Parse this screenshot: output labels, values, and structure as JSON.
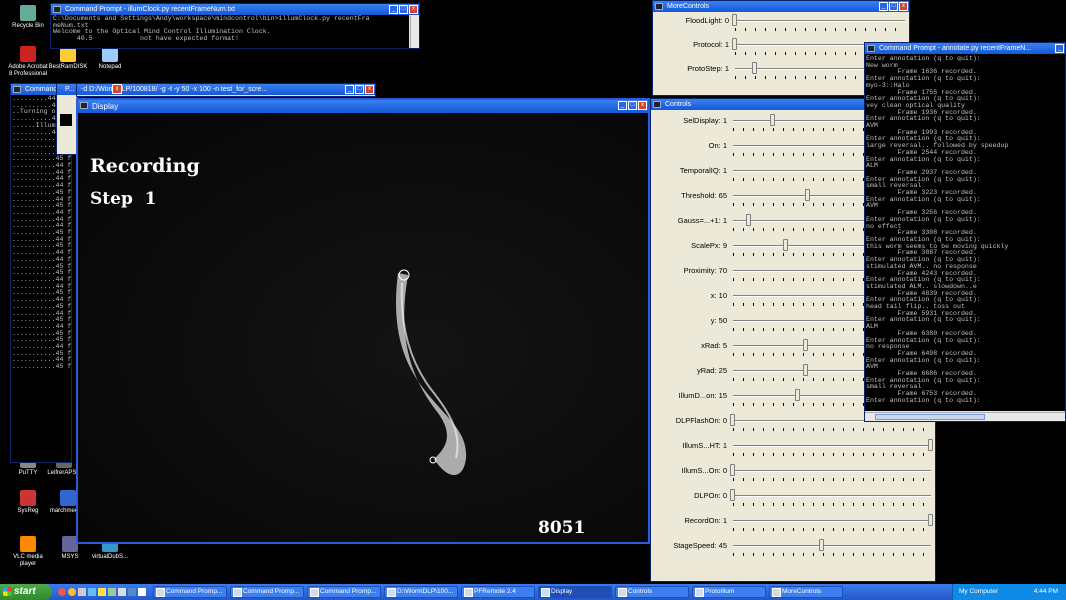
{
  "desktop": {
    "icons": [
      {
        "name": "recycle-bin-icon",
        "label": "Recycle Bin",
        "color": "#6a9"
      },
      {
        "name": "acrobat-icon",
        "label": "Adobe Acrobat 8 Professional",
        "color": "#c22"
      },
      {
        "name": "bestramdisk-icon",
        "label": "BestRamDISK",
        "color": "#fc3"
      },
      {
        "name": "notepad-icon",
        "label": "Notepad",
        "color": "#9cf"
      },
      {
        "name": "putty-icon",
        "label": "PuTTY",
        "color": "#888"
      },
      {
        "name": "lehrer-icon",
        "label": "LeifrerAPSR",
        "color": "#666"
      },
      {
        "name": "sysreg-icon",
        "label": "SysReg",
        "color": "#c33"
      },
      {
        "name": "marchmeeting-icon",
        "label": "marchmeeti...",
        "color": "#36c"
      },
      {
        "name": "vlc-icon",
        "label": "VLC media player",
        "color": "#f80"
      },
      {
        "name": "msys-icon",
        "label": "MSYS",
        "color": "#669"
      },
      {
        "name": "virtualdub-icon",
        "label": "virtualDubS...",
        "color": "#39c"
      }
    ]
  },
  "illum_window": {
    "title": "Command Prompt - illumClock.py recentFrameNum.txt",
    "lines": [
      "C:\\Documents and Settings\\Andy\\workspace\\mindcontrol\\bin>illumClock.py recentFra",
      "meNum.txt",
      "Welcome to the Optical Mind Control Illumination Clock.",
      "      40.5            not have expected format!"
    ]
  },
  "back_cmd": {
    "title": "Command",
    "lines": [
      ".........44 fps",
      "..........44 fps",
      "..Turning on DLP",
      "..........44 fps",
      "......Illuminat",
      "..........44 fps",
      "...........44 fp",
      "...........44 fp",
      "...........44 fp",
      "...........45 fp",
      "...........44 fp",
      "...........44 fp",
      "...........44 fp",
      "...........44 fp",
      "...........45 fp",
      "...........44 fp",
      "...........45 fp",
      "...........44 fp",
      "...........44 fp",
      "...........44 fp",
      "...........45 fp",
      "...........44 fp",
      "...........45 fp",
      "...........44 fp",
      "...........44 fp",
      "...........45 fp",
      "...........45 fp",
      "...........44 fp",
      "...........44 fp",
      "...........45 fp",
      "...........44 fp",
      "...........45 fp",
      "...........44 fp",
      "...........45 fp",
      "...........44 fp",
      "...........45 fp",
      "...........45 fp",
      "...........44 fp",
      "...........45 fp",
      "...........44 fp",
      "...........45 fp"
    ],
    "small_title": "P...",
    "dlp_title": "-d D:/WormDLP/100818/ -g -t -y 50 -x 100 -n test_for_scre..."
  },
  "display_window": {
    "title": "Display",
    "status_line1": "Recording",
    "status_line2": "Step  1",
    "frame_number": "8051"
  },
  "more_controls": {
    "title": "MoreControls",
    "sliders": [
      {
        "label": "FloodLight: 0",
        "value": 0
      },
      {
        "label": "Protocol: 1",
        "value": 0.0
      },
      {
        "label": "ProtoStep: 1",
        "value": 0.12
      }
    ]
  },
  "controls": {
    "title": "Controls",
    "sliders": [
      {
        "label": "SelDisplay: 1",
        "value": 0.2
      },
      {
        "label": "On: 1",
        "value": 1.0
      },
      {
        "label": "TemporalIQ: 1",
        "value": 1.0
      },
      {
        "label": "Threshold: 65",
        "value": 0.38
      },
      {
        "label": "Gauss=...+1: 1",
        "value": 0.08
      },
      {
        "label": "ScalePx: 9",
        "value": 0.27
      },
      {
        "label": "Proximity: 70",
        "value": 1.0
      },
      {
        "label": "x: 10",
        "value": 0.74
      },
      {
        "label": "y: 50",
        "value": 0.74
      },
      {
        "label": "xRad: 5",
        "value": 0.37
      },
      {
        "label": "yRad: 25",
        "value": 0.37
      },
      {
        "label": "IllumD...on: 15",
        "value": 0.33
      },
      {
        "label": "DLPFlashOn: 0",
        "value": 0.0
      },
      {
        "label": "IllumS...HT: 1",
        "value": 1.0
      },
      {
        "label": "IllumS...On: 0",
        "value": 0.0
      },
      {
        "label": "DLPOn: 0",
        "value": 0.0
      },
      {
        "label": "RecordOn: 1",
        "value": 1.0
      },
      {
        "label": "StageSpeed: 45",
        "value": 0.45
      }
    ]
  },
  "annotate_window": {
    "title": "Command Prompt - annotate.py recentFrameN...",
    "lines": [
      "Enter annotation (q to quit):",
      "New worm",
      "        Frame 1636 recorded.",
      "Enter annotation (q to quit):",
      "myo-3::Halo",
      "        Frame 1755 recorded.",
      "Enter annotation (q to quit):",
      "vey clean optical quality",
      "        Frame 1936 recorded.",
      "Enter annotation (q to quit):",
      "AVM",
      "        Frame 1993 recorded.",
      "Enter annotation (q to quit):",
      "large reversal.. followed by speedup",
      "        Frame 2544 recorded.",
      "Enter annotation (q to quit):",
      "ALM",
      "        Frame 2937 recorded.",
      "Enter annotation (q to quit):",
      "small reversal",
      "        Frame 3223 recorded.",
      "Enter annotation (q to quit):",
      "AVM",
      "        Frame 3256 recorded.",
      "Enter annotation (q to quit):",
      "no effect",
      "        Frame 3308 recorded.",
      "Enter annotation (q to quit):",
      "this worm seems to be moving quickly",
      "        Frame 3887 recorded.",
      "Enter annotation (q to quit):",
      "stimulated AVM.. no response",
      "        Frame 4243 recorded.",
      "Enter annotation (q to quit):",
      "stimulated ALM.. slowdown..e",
      "        Frame 4839 recorded.",
      "Enter annotation (q to quit):",
      "head tail flip.. toss out",
      "        Frame 5931 recorded.",
      "Enter annotation (q to quit):",
      "ALM",
      "        Frame 6380 recorded.",
      "Enter annotation (q to quit):",
      "no response",
      "        Frame 6498 recorded.",
      "Enter annotation (q to quit):",
      "AVM",
      "        Frame 6686 recorded.",
      "Enter annotation (q to quit):",
      "small reversal",
      "        Frame 6753 recorded.",
      "Enter annotation (q to quit):"
    ]
  },
  "taskbar": {
    "start_label": "start",
    "tasks": [
      {
        "label": "Command Promp...",
        "active": false
      },
      {
        "label": "Command Promp...",
        "active": false
      },
      {
        "label": "Command Promp...",
        "active": false
      },
      {
        "label": "D:\\WormDLP\\100...",
        "active": false
      },
      {
        "label": "PFRemote 2.4",
        "active": false
      },
      {
        "label": "Display",
        "active": true
      },
      {
        "label": "Controls",
        "active": false
      },
      {
        "label": "ProtoIllum",
        "active": false
      },
      {
        "label": "MoreControls",
        "active": false
      }
    ],
    "tray_label": "My Computer",
    "clock": "4:44 PM"
  }
}
